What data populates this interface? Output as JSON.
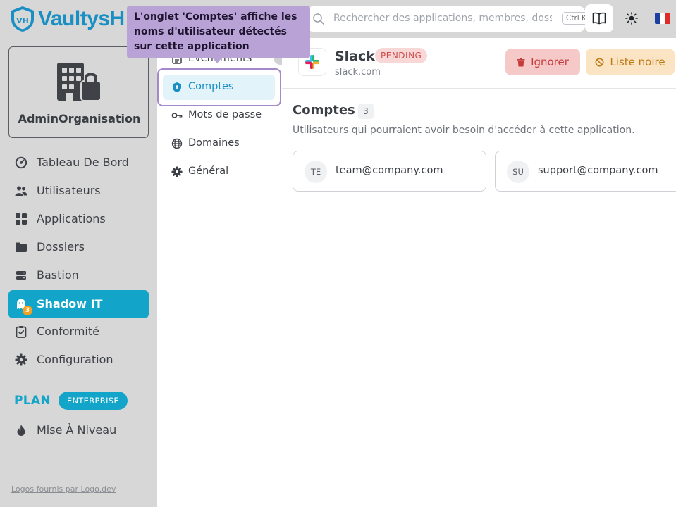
{
  "header": {
    "logo_text": "VaultysH",
    "logo_badge": "VH",
    "search_placeholder": "Rechercher des applications, membres, dossiers",
    "search_shortcut": "Ctrl K"
  },
  "tooltip": {
    "text": "L'onglet 'Comptes' affiche les noms d'utilisateur détectés sur cette application"
  },
  "sidebar": {
    "org_name": "AdminOrganisation",
    "items": [
      {
        "label": "Tableau De Bord",
        "icon": "dashboard-gauge-icon"
      },
      {
        "label": "Utilisateurs",
        "icon": "users-icon"
      },
      {
        "label": "Applications",
        "icon": "grid-icon"
      },
      {
        "label": "Dossiers",
        "icon": "folder-icon"
      },
      {
        "label": "Bastion",
        "icon": "server-icon"
      },
      {
        "label": "Shadow IT",
        "icon": "ghost-icon",
        "badge": "3",
        "active": true
      },
      {
        "label": "Conformité",
        "icon": "clipboard-check-icon"
      },
      {
        "label": "Configuration",
        "icon": "gear-icon"
      }
    ],
    "plan_label": "PLAN",
    "plan_badge": "ENTERPRISE",
    "upgrade_label": "Mise À Niveau",
    "logos_credit": "Logos fournis par Logo.dev"
  },
  "tabs": [
    {
      "label": "Événements",
      "icon": "list-icon"
    },
    {
      "label": "Comptes",
      "icon": "shield-icon",
      "active": true
    },
    {
      "label": "Mots de passe",
      "icon": "key-icon"
    },
    {
      "label": "Domaines",
      "icon": "globe-icon"
    },
    {
      "label": "Général",
      "icon": "gear-icon"
    }
  ],
  "app": {
    "name": "Slack",
    "status": "PENDING",
    "domain": "slack.com",
    "ignore_label": "Ignorer",
    "blacklist_label": "Liste noire"
  },
  "accounts": {
    "title": "Comptes",
    "count": "3",
    "description": "Utilisateurs qui pourraient avoir besoin d'accéder à cette application.",
    "items": [
      {
        "initials": "TE",
        "email": "team@company.com"
      },
      {
        "initials": "SU",
        "email": "support@company.com"
      }
    ]
  },
  "colors": {
    "brand": "#1a8fc4",
    "active_nav": "#13a5c9",
    "tooltip": "#b9a3d6",
    "status_pending": "#d04a4a"
  }
}
